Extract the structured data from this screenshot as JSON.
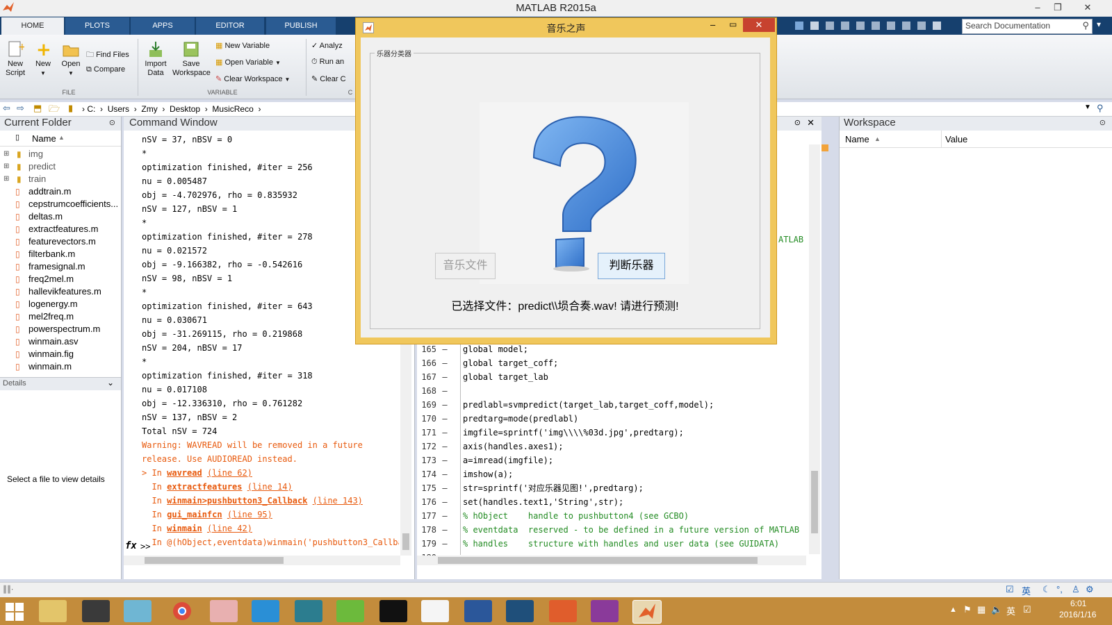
{
  "window": {
    "title": "MATLAB R2015a"
  },
  "ribbon": {
    "tabs": [
      "HOME",
      "PLOTS",
      "APPS",
      "EDITOR",
      "PUBLISH"
    ],
    "new_script": "New Script",
    "new": "New",
    "open": "Open",
    "find_files": "Find Files",
    "compare": "Compare",
    "file_group": "FILE",
    "import_data": "Import Data",
    "save_workspace": "Save Workspace",
    "new_variable": "New Variable",
    "open_variable": "Open Variable",
    "clear_workspace": "Clear Workspace",
    "variable_group": "VARIABLE",
    "analyze": "Analyz",
    "run_and": "Run an",
    "clear_c": "Clear C",
    "c_group": "C"
  },
  "search": {
    "placeholder": "Search Documentation"
  },
  "address": {
    "crumbs": [
      "C:",
      "Users",
      "Zmy",
      "Desktop",
      "MusicReco"
    ]
  },
  "current_folder": {
    "title": "Current Folder",
    "col_name": "Name",
    "items": [
      "img",
      "predict",
      "train",
      "addtrain.m",
      "cepstrumcoefficients...",
      "deltas.m",
      "extractfeatures.m",
      "featurevectors.m",
      "filterbank.m",
      "framesignal.m",
      "freq2mel.m",
      "hallevikfeatures.m",
      "logenergy.m",
      "mel2freq.m",
      "powerspectrum.m",
      "winmain.asv",
      "winmain.fig",
      "winmain.m"
    ],
    "details_title": "Details",
    "details_text": "Select a file to view details"
  },
  "command_window": {
    "title": "Command Window",
    "lines": [
      "nSV = 37, nBSV = 0",
      "*",
      "optimization finished, #iter = 256",
      "nu = 0.005487",
      "obj = -4.702976, rho = 0.835932",
      "nSV = 127, nBSV = 1",
      "*",
      "optimization finished, #iter = 278",
      "nu = 0.021572",
      "obj = -9.166382, rho = -0.542616",
      "nSV = 98, nBSV = 1",
      "*",
      "optimization finished, #iter = 643",
      "nu = 0.030671",
      "obj = -31.269115, rho = 0.219868",
      "nSV = 204, nBSV = 17",
      "*",
      "optimization finished, #iter = 318",
      "nu = 0.017108",
      "obj = -12.336310, rho = 0.761282",
      "nSV = 137, nBSV = 2",
      "Total nSV = 724"
    ],
    "warning1": "Warning: WAVREAD will be removed in a future",
    "warning2": "release. Use AUDIOREAD instead.",
    "stack": [
      {
        "prefix": "> In ",
        "fn": "wavread",
        "line": "(line 62)"
      },
      {
        "prefix": "  In ",
        "fn": "extractfeatures",
        "line": "(line 14)"
      },
      {
        "prefix": "  In ",
        "fn": "winmain>pushbutton3_Callback",
        "line": "(line 143)"
      },
      {
        "prefix": "  In ",
        "fn": "gui_mainfcn",
        "line": "(line 95)"
      },
      {
        "prefix": "  In ",
        "fn": "winmain",
        "line": "(line 42)"
      }
    ],
    "last_line": "  In @(hObject,eventdata)winmain('pushbutton3_Callbac",
    "prompt": ">>",
    "fx": "fx"
  },
  "editor": {
    "partial": "ATLAB",
    "lines": [
      {
        "n": "165",
        "code": "global model;"
      },
      {
        "n": "166",
        "code": "global target_coff;"
      },
      {
        "n": "167",
        "code": "global target_lab"
      },
      {
        "n": "168",
        "code": ""
      },
      {
        "n": "169",
        "code": "predlabl=svmpredict(target_lab,target_coff,model);"
      },
      {
        "n": "170",
        "code": "predtarg=mode(predlabl)"
      },
      {
        "n": "171",
        "code": "imgfile=sprintf('img\\\\\\\\%03d.jpg',predtarg);"
      },
      {
        "n": "172",
        "code": "axis(handles.axes1);"
      },
      {
        "n": "173",
        "code": "a=imread(imgfile);"
      },
      {
        "n": "174",
        "code": "imshow(a);"
      },
      {
        "n": "175",
        "code": "str=sprintf('对应乐器见图!',predtarg);"
      },
      {
        "n": "176",
        "code": "set(handles.text1,'String',str);"
      },
      {
        "n": "177",
        "code": "% hObject    handle to pushbutton4 (see GCBO)"
      },
      {
        "n": "178",
        "code": "% eventdata  reserved - to be defined in a future version of MATLAB"
      },
      {
        "n": "179",
        "code": "% handles    structure with handles and user data (see GUIDATA)"
      },
      {
        "n": "180",
        "code": ""
      }
    ]
  },
  "workspace": {
    "title": "Workspace",
    "col_name": "Name",
    "col_value": "Value"
  },
  "dialog": {
    "title": "音乐之声",
    "group": "乐器分类器",
    "btn_music": "音乐文件",
    "btn_judge": "判断乐器",
    "message": "已选择文件：predict\\\\埙合奏.wav! 请进行预测!"
  },
  "taskbar": {
    "ime": "英",
    "time": "6:01",
    "date": "2016/1/16",
    "status_ime": "英"
  },
  "colors": {
    "ribbon_tab_bar": "#16406e",
    "dialog_border": "#f0c75c",
    "warning": "#e8590c",
    "question_mark": "#4a8ee0"
  }
}
